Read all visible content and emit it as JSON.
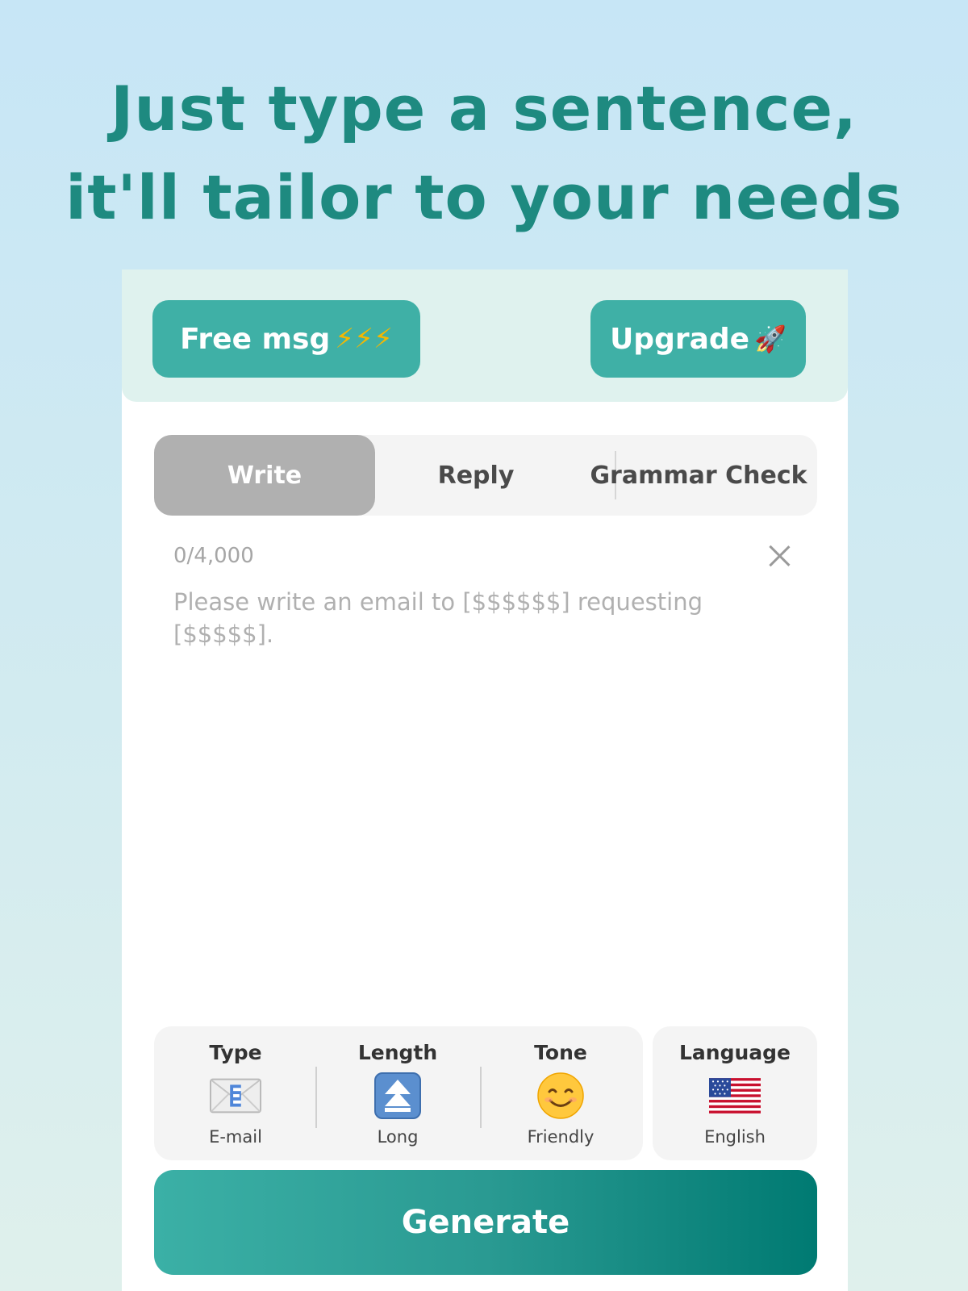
{
  "headline": {
    "line1": "Just type a sentence,",
    "line2": "it'll tailor to your needs"
  },
  "header": {
    "free_label": "Free msg",
    "free_icons": "⚡⚡⚡",
    "upgrade_label": "Upgrade",
    "upgrade_icon": "🚀"
  },
  "tabs": [
    {
      "label": "Write",
      "active": true
    },
    {
      "label": "Reply",
      "active": false
    },
    {
      "label": "Grammar Check",
      "active": false
    }
  ],
  "editor": {
    "counter": "0/4,000",
    "value": "",
    "placeholder": "Please write an email to [$$$$$$] requesting [$$$$$]."
  },
  "options": {
    "type": {
      "label": "Type",
      "value": "E-mail",
      "icon": "envelope-e-icon"
    },
    "length": {
      "label": "Length",
      "value": "Long",
      "icon": "double-up-arrow-icon"
    },
    "tone": {
      "label": "Tone",
      "value": "Friendly",
      "icon": "smiling-face-icon"
    },
    "language": {
      "label": "Language",
      "value": "English",
      "icon": "us-flag-icon"
    }
  },
  "generate_label": "Generate",
  "colors": {
    "accent": "#3fb0a6",
    "headline": "#1e8a80",
    "tab_active": "#b0b0b0"
  }
}
